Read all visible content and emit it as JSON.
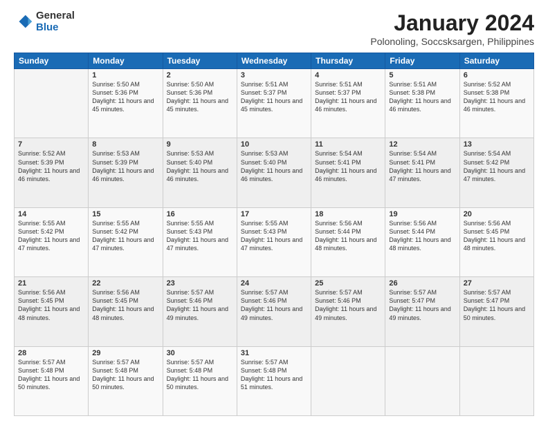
{
  "logo": {
    "general": "General",
    "blue": "Blue"
  },
  "title": "January 2024",
  "subtitle": "Polonoling, Soccsksargen, Philippines",
  "weekdays": [
    "Sunday",
    "Monday",
    "Tuesday",
    "Wednesday",
    "Thursday",
    "Friday",
    "Saturday"
  ],
  "weeks": [
    [
      {
        "day": "",
        "info": ""
      },
      {
        "day": "1",
        "info": "Sunrise: 5:50 AM\nSunset: 5:36 PM\nDaylight: 11 hours\nand 45 minutes."
      },
      {
        "day": "2",
        "info": "Sunrise: 5:50 AM\nSunset: 5:36 PM\nDaylight: 11 hours\nand 45 minutes."
      },
      {
        "day": "3",
        "info": "Sunrise: 5:51 AM\nSunset: 5:37 PM\nDaylight: 11 hours\nand 45 minutes."
      },
      {
        "day": "4",
        "info": "Sunrise: 5:51 AM\nSunset: 5:37 PM\nDaylight: 11 hours\nand 46 minutes."
      },
      {
        "day": "5",
        "info": "Sunrise: 5:51 AM\nSunset: 5:38 PM\nDaylight: 11 hours\nand 46 minutes."
      },
      {
        "day": "6",
        "info": "Sunrise: 5:52 AM\nSunset: 5:38 PM\nDaylight: 11 hours\nand 46 minutes."
      }
    ],
    [
      {
        "day": "7",
        "info": ""
      },
      {
        "day": "8",
        "info": "Sunrise: 5:53 AM\nSunset: 5:39 PM\nDaylight: 11 hours\nand 46 minutes."
      },
      {
        "day": "9",
        "info": "Sunrise: 5:53 AM\nSunset: 5:40 PM\nDaylight: 11 hours\nand 46 minutes."
      },
      {
        "day": "10",
        "info": "Sunrise: 5:53 AM\nSunset: 5:40 PM\nDaylight: 11 hours\nand 46 minutes."
      },
      {
        "day": "11",
        "info": "Sunrise: 5:54 AM\nSunset: 5:41 PM\nDaylight: 11 hours\nand 46 minutes."
      },
      {
        "day": "12",
        "info": "Sunrise: 5:54 AM\nSunset: 5:41 PM\nDaylight: 11 hours\nand 47 minutes."
      },
      {
        "day": "13",
        "info": "Sunrise: 5:54 AM\nSunset: 5:42 PM\nDaylight: 11 hours\nand 47 minutes."
      }
    ],
    [
      {
        "day": "14",
        "info": ""
      },
      {
        "day": "15",
        "info": "Sunrise: 5:55 AM\nSunset: 5:42 PM\nDaylight: 11 hours\nand 47 minutes."
      },
      {
        "day": "16",
        "info": "Sunrise: 5:55 AM\nSunset: 5:43 PM\nDaylight: 11 hours\nand 47 minutes."
      },
      {
        "day": "17",
        "info": "Sunrise: 5:55 AM\nSunset: 5:43 PM\nDaylight: 11 hours\nand 47 minutes."
      },
      {
        "day": "18",
        "info": "Sunrise: 5:56 AM\nSunset: 5:44 PM\nDaylight: 11 hours\nand 48 minutes."
      },
      {
        "day": "19",
        "info": "Sunrise: 5:56 AM\nSunset: 5:44 PM\nDaylight: 11 hours\nand 48 minutes."
      },
      {
        "day": "20",
        "info": "Sunrise: 5:56 AM\nSunset: 5:45 PM\nDaylight: 11 hours\nand 48 minutes."
      }
    ],
    [
      {
        "day": "21",
        "info": ""
      },
      {
        "day": "22",
        "info": "Sunrise: 5:56 AM\nSunset: 5:45 PM\nDaylight: 11 hours\nand 48 minutes."
      },
      {
        "day": "23",
        "info": "Sunrise: 5:57 AM\nSunset: 5:46 PM\nDaylight: 11 hours\nand 49 minutes."
      },
      {
        "day": "24",
        "info": "Sunrise: 5:57 AM\nSunset: 5:46 PM\nDaylight: 11 hours\nand 49 minutes."
      },
      {
        "day": "25",
        "info": "Sunrise: 5:57 AM\nSunset: 5:46 PM\nDaylight: 11 hours\nand 49 minutes."
      },
      {
        "day": "26",
        "info": "Sunrise: 5:57 AM\nSunset: 5:47 PM\nDaylight: 11 hours\nand 49 minutes."
      },
      {
        "day": "27",
        "info": "Sunrise: 5:57 AM\nSunset: 5:47 PM\nDaylight: 11 hours\nand 50 minutes."
      }
    ],
    [
      {
        "day": "28",
        "info": ""
      },
      {
        "day": "29",
        "info": "Sunrise: 5:57 AM\nSunset: 5:48 PM\nDaylight: 11 hours\nand 50 minutes."
      },
      {
        "day": "30",
        "info": "Sunrise: 5:57 AM\nSunset: 5:48 PM\nDaylight: 11 hours\nand 50 minutes."
      },
      {
        "day": "31",
        "info": "Sunrise: 5:57 AM\nSunset: 5:48 PM\nDaylight: 11 hours\nand 51 minutes."
      },
      {
        "day": "",
        "info": ""
      },
      {
        "day": "",
        "info": ""
      },
      {
        "day": "",
        "info": ""
      }
    ]
  ],
  "week1_day7_info": "Sunrise: 5:52 AM\nSunset: 5:39 PM\nDaylight: 11 hours\nand 46 minutes.",
  "week2_day14_info": "Sunrise: 5:55 AM\nSunset: 5:42 PM\nDaylight: 11 hours\nand 47 minutes.",
  "week3_day21_info": "Sunrise: 5:56 AM\nSunset: 5:45 PM\nDaylight: 11 hours\nand 48 minutes.",
  "week4_day28_info": "Sunrise: 5:57 AM\nSunset: 5:48 PM\nDaylight: 11 hours\nand 50 minutes."
}
